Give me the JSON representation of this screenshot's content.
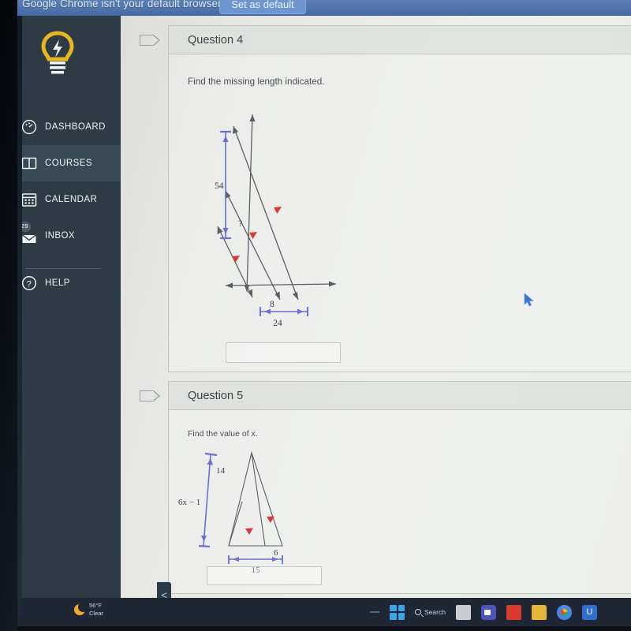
{
  "browser_notice": {
    "message": "Google Chrome isn't your default browser",
    "button_label": "Set as default",
    "logo_icon": "chrome-logo-icon"
  },
  "sidebar": {
    "logo_icon": "lightbulb-logo-icon",
    "items": [
      {
        "label": "DASHBOARD",
        "icon": "dashboard-speedometer-icon",
        "badge": "",
        "active": false
      },
      {
        "label": "COURSES",
        "icon": "courses-book-icon",
        "badge": "",
        "active": true
      },
      {
        "label": "CALENDAR",
        "icon": "calendar-icon",
        "badge": "",
        "active": false
      },
      {
        "label": "INBOX",
        "icon": "inbox-envelope-icon",
        "badge": "29",
        "active": false
      },
      {
        "label": "HELP",
        "icon": "help-question-icon",
        "badge": "",
        "active": false
      }
    ],
    "collapse_label": "<"
  },
  "questions": [
    {
      "header": "Question 4",
      "prompt": "Find the missing length indicated.",
      "answer_value": "",
      "figure": {
        "type": "parallel-lines-transversal",
        "labels": [
          "54",
          "?",
          "8",
          "24"
        ],
        "dimension_color": "#6b6fd6",
        "tick_color": "#d73a3a",
        "line_color": "#5a5f66"
      }
    },
    {
      "header": "Question 5",
      "prompt": "Find the value of x.",
      "answer_value": "",
      "figure": {
        "type": "similar-triangles",
        "labels": [
          "14",
          "6x − 1",
          "6",
          "15"
        ],
        "dimension_color": "#6b6fd6",
        "tick_color": "#d73a3a",
        "line_color": "#5a5f66"
      }
    }
  ],
  "taskbar": {
    "weather_temp": "56°F",
    "weather_cond": "Clear",
    "weather_icon": "crescent-moon-icon",
    "search_label": "Search",
    "start_icon": "windows-start-icon",
    "apps": [
      {
        "name": "task-view-icon",
        "color": "#c9cdd2"
      },
      {
        "name": "teams-camera-icon",
        "color": "#4b53bc"
      },
      {
        "name": "red-app-icon",
        "color": "#d63b2c"
      },
      {
        "name": "file-explorer-icon",
        "color": "#e8b33a"
      },
      {
        "name": "google-chrome-icon",
        "color": "#34a853"
      },
      {
        "name": "blue-u-app-icon",
        "color": "#2f6fd0"
      }
    ]
  },
  "cursor": {
    "icon": "mouse-pointer-icon",
    "color": "#3b6fd4"
  }
}
